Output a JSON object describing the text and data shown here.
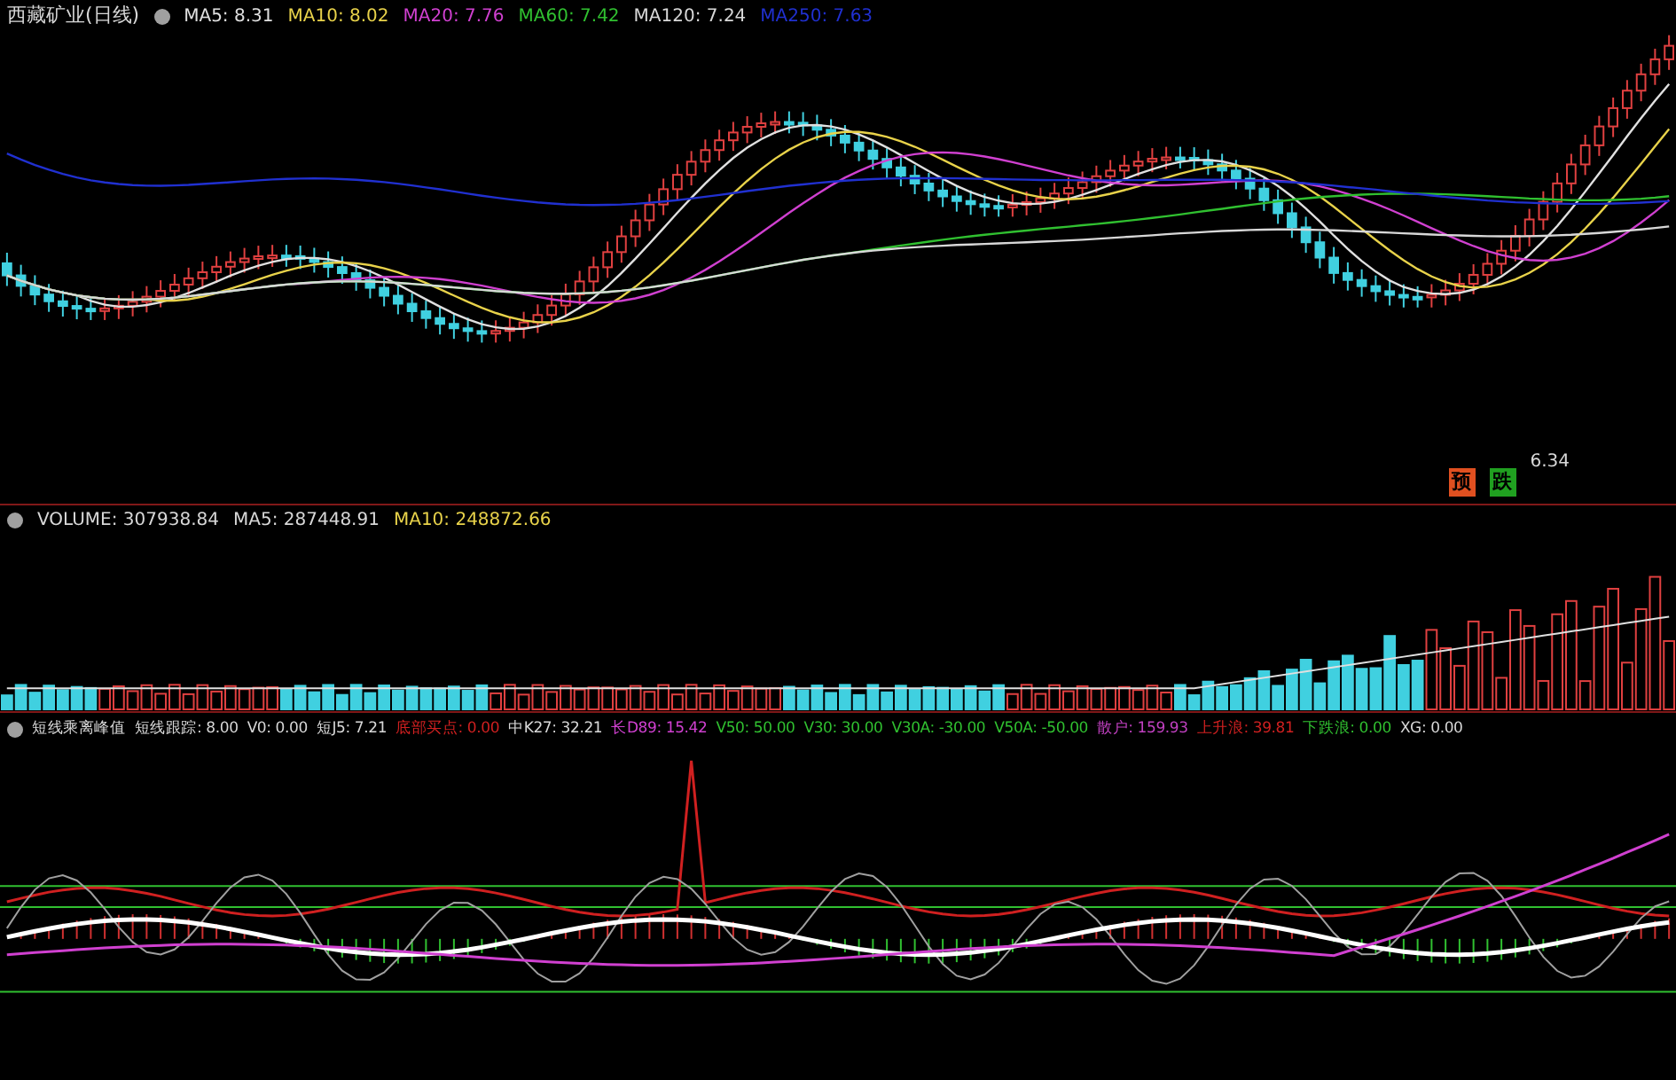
{
  "price_panel": {
    "title": "西藏矿业(日线)",
    "legend": [
      {
        "text": "MA5: 8.31",
        "color": "#e0e0e0"
      },
      {
        "text": "MA10: 8.02",
        "color": "#e8d24a"
      },
      {
        "text": "MA20: 7.76",
        "color": "#d040d0"
      },
      {
        "text": "MA60: 7.42",
        "color": "#30c030"
      },
      {
        "text": "MA120: 7.24",
        "color": "#d8d8d8"
      },
      {
        "text": "MA250: 7.63",
        "color": "#2030d0"
      }
    ],
    "low_label": "6.34",
    "signals": [
      {
        "text": "预",
        "color": "#e05020"
      },
      {
        "text": "跌",
        "color": "#20a020"
      }
    ]
  },
  "volume_panel": {
    "legend": [
      {
        "text": "VOLUME: 307938.84",
        "color": "#d8d8d8"
      },
      {
        "text": "MA5: 287448.91",
        "color": "#d8d8d8"
      },
      {
        "text": "MA10: 248872.66",
        "color": "#e8d24a"
      }
    ]
  },
  "indicator_panel": {
    "title": "短线乘离峰值",
    "legend": [
      {
        "text": "短线跟踪: 8.00",
        "color": "#d8d8d8"
      },
      {
        "text": "V0: 0.00",
        "color": "#d8d8d8"
      },
      {
        "text": "短J5: 7.21",
        "color": "#d8d8d8"
      },
      {
        "text": "底部买点: 0.00",
        "color": "#d02020"
      },
      {
        "text": "中K27: 32.21",
        "color": "#d8d8d8"
      },
      {
        "text": "长D89: 15.42",
        "color": "#d040d0"
      },
      {
        "text": "V50: 50.00",
        "color": "#30c030"
      },
      {
        "text": "V30: 30.00",
        "color": "#30c030"
      },
      {
        "text": "V30A: -30.00",
        "color": "#30c030"
      },
      {
        "text": "V50A: -50.00",
        "color": "#30c030"
      },
      {
        "text": "散户: 159.93",
        "color": "#c040c0"
      },
      {
        "text": "上升浪: 39.81",
        "color": "#d02020"
      },
      {
        "text": "下跌浪: 0.00",
        "color": "#30c030"
      },
      {
        "text": "XG: 0.00",
        "color": "#d8d8d8"
      }
    ]
  }
}
